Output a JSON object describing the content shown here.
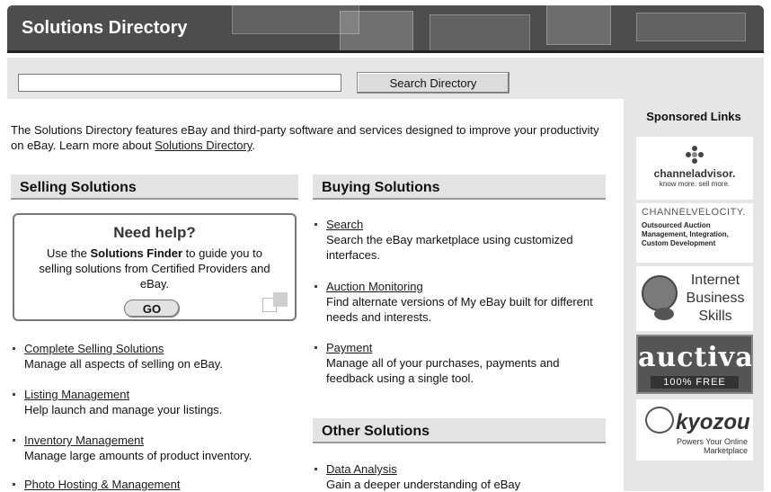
{
  "header": {
    "title": "Solutions Directory"
  },
  "search": {
    "input_value": "",
    "button_label": "Search Directory"
  },
  "intro": {
    "text": "The Solutions Directory features eBay and third-party software and services designed to improve your productivity on eBay. Learn more about ",
    "link": "Solutions Directory",
    "suffix": "."
  },
  "selling": {
    "heading": "Selling Solutions",
    "help": {
      "title": "Need help?",
      "text_before": "Use the ",
      "text_bold": "Solutions Finder",
      "text_after": " to guide you to selling solutions from Certified Providers and eBay.",
      "go_label": "GO"
    },
    "items": [
      {
        "title": "Complete Selling Solutions",
        "desc": "Manage all aspects of selling on eBay."
      },
      {
        "title": "Listing Management",
        "desc": "Help launch and manage your listings."
      },
      {
        "title": "Inventory Management",
        "desc": "Manage large amounts of product inventory."
      },
      {
        "title": "Photo Hosting & Management",
        "desc": ""
      }
    ]
  },
  "buying": {
    "heading": "Buying Solutions",
    "items": [
      {
        "title": "Search",
        "desc": "Search the eBay marketplace using customized interfaces."
      },
      {
        "title": "Auction Monitoring",
        "desc": "Find alternate versions of My eBay built for different needs and interests."
      },
      {
        "title": "Payment",
        "desc": "Manage all of your purchases, payments and feedback using a single tool."
      }
    ]
  },
  "other": {
    "heading": "Other Solutions",
    "items": [
      {
        "title": "Data Analysis",
        "desc": "Gain a deeper understanding of eBay"
      }
    ]
  },
  "sponsored": {
    "title": "Sponsored Links",
    "ads": [
      {
        "brand": "channeladvisor.",
        "tag": "know more. sell more."
      },
      {
        "brand": "CHANNELVELOCITY.",
        "tag": "Outsourced Auction Management, Integration, Custom Development"
      },
      {
        "brand": "Internet Business Skills"
      },
      {
        "brand": "auctiva",
        "tag": "100% FREE"
      },
      {
        "brand": "kyozou",
        "tag": "Powers Your Online Marketplace"
      }
    ]
  }
}
